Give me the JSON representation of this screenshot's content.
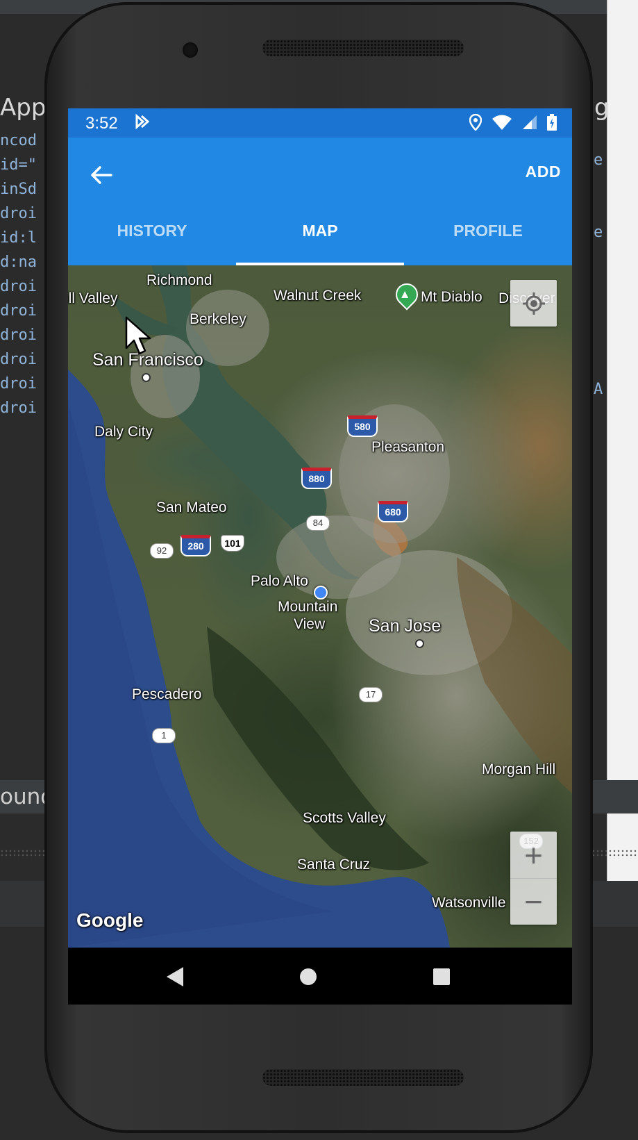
{
  "ide": {
    "title_fragment": "App.",
    "right_fragment": "g",
    "code_lines": [
      "ncod",
      "id=\"",
      "inSd",
      "droi",
      "id:l",
      "d:na",
      "",
      "droi",
      "droi",
      "droi",
      "droi",
      "droi",
      "droi"
    ],
    "right_code": [
      "e",
      "e",
      "A"
    ],
    "bottom_fragment": "ound"
  },
  "status_bar": {
    "time": "3:52",
    "icons": [
      "notification-icon",
      "location-icon",
      "wifi-icon",
      "signal-icon",
      "battery-icon"
    ]
  },
  "app_bar": {
    "add_label": "ADD",
    "tabs": [
      {
        "label": "HISTORY",
        "active": false
      },
      {
        "label": "MAP",
        "active": true
      },
      {
        "label": "PROFILE",
        "active": false
      }
    ]
  },
  "map": {
    "labels": {
      "richmond": "Richmond",
      "mill_valley": "ill Valley",
      "walnut_creek": "Walnut Creek",
      "mt_diablo": "Mt Diablo",
      "discovery": "Discover",
      "berkeley": "Berkeley",
      "san_francisco": "San Francisco",
      "daly_city": "Daly City",
      "pleasanton": "Pleasanton",
      "san_mateo": "San Mateo",
      "palo_alto": "Palo Alto",
      "mountain_view": "Mountain",
      "mountain_view_2": "View",
      "san_jose": "San Jose",
      "pescadero": "Pescadero",
      "morgan_hill": "Morgan Hill",
      "scotts_valley": "Scotts Valley",
      "santa_cruz": "Santa Cruz",
      "watsonville": "Watsonville"
    },
    "shields": {
      "i580": "580",
      "i880": "880",
      "i680": "680",
      "i280": "280",
      "us101": "101",
      "ca84": "84",
      "ca92": "92",
      "ca17": "17",
      "ca1": "1",
      "ca152": "152"
    },
    "attribution": "Google",
    "zoom_in": "+",
    "zoom_out": "−"
  }
}
